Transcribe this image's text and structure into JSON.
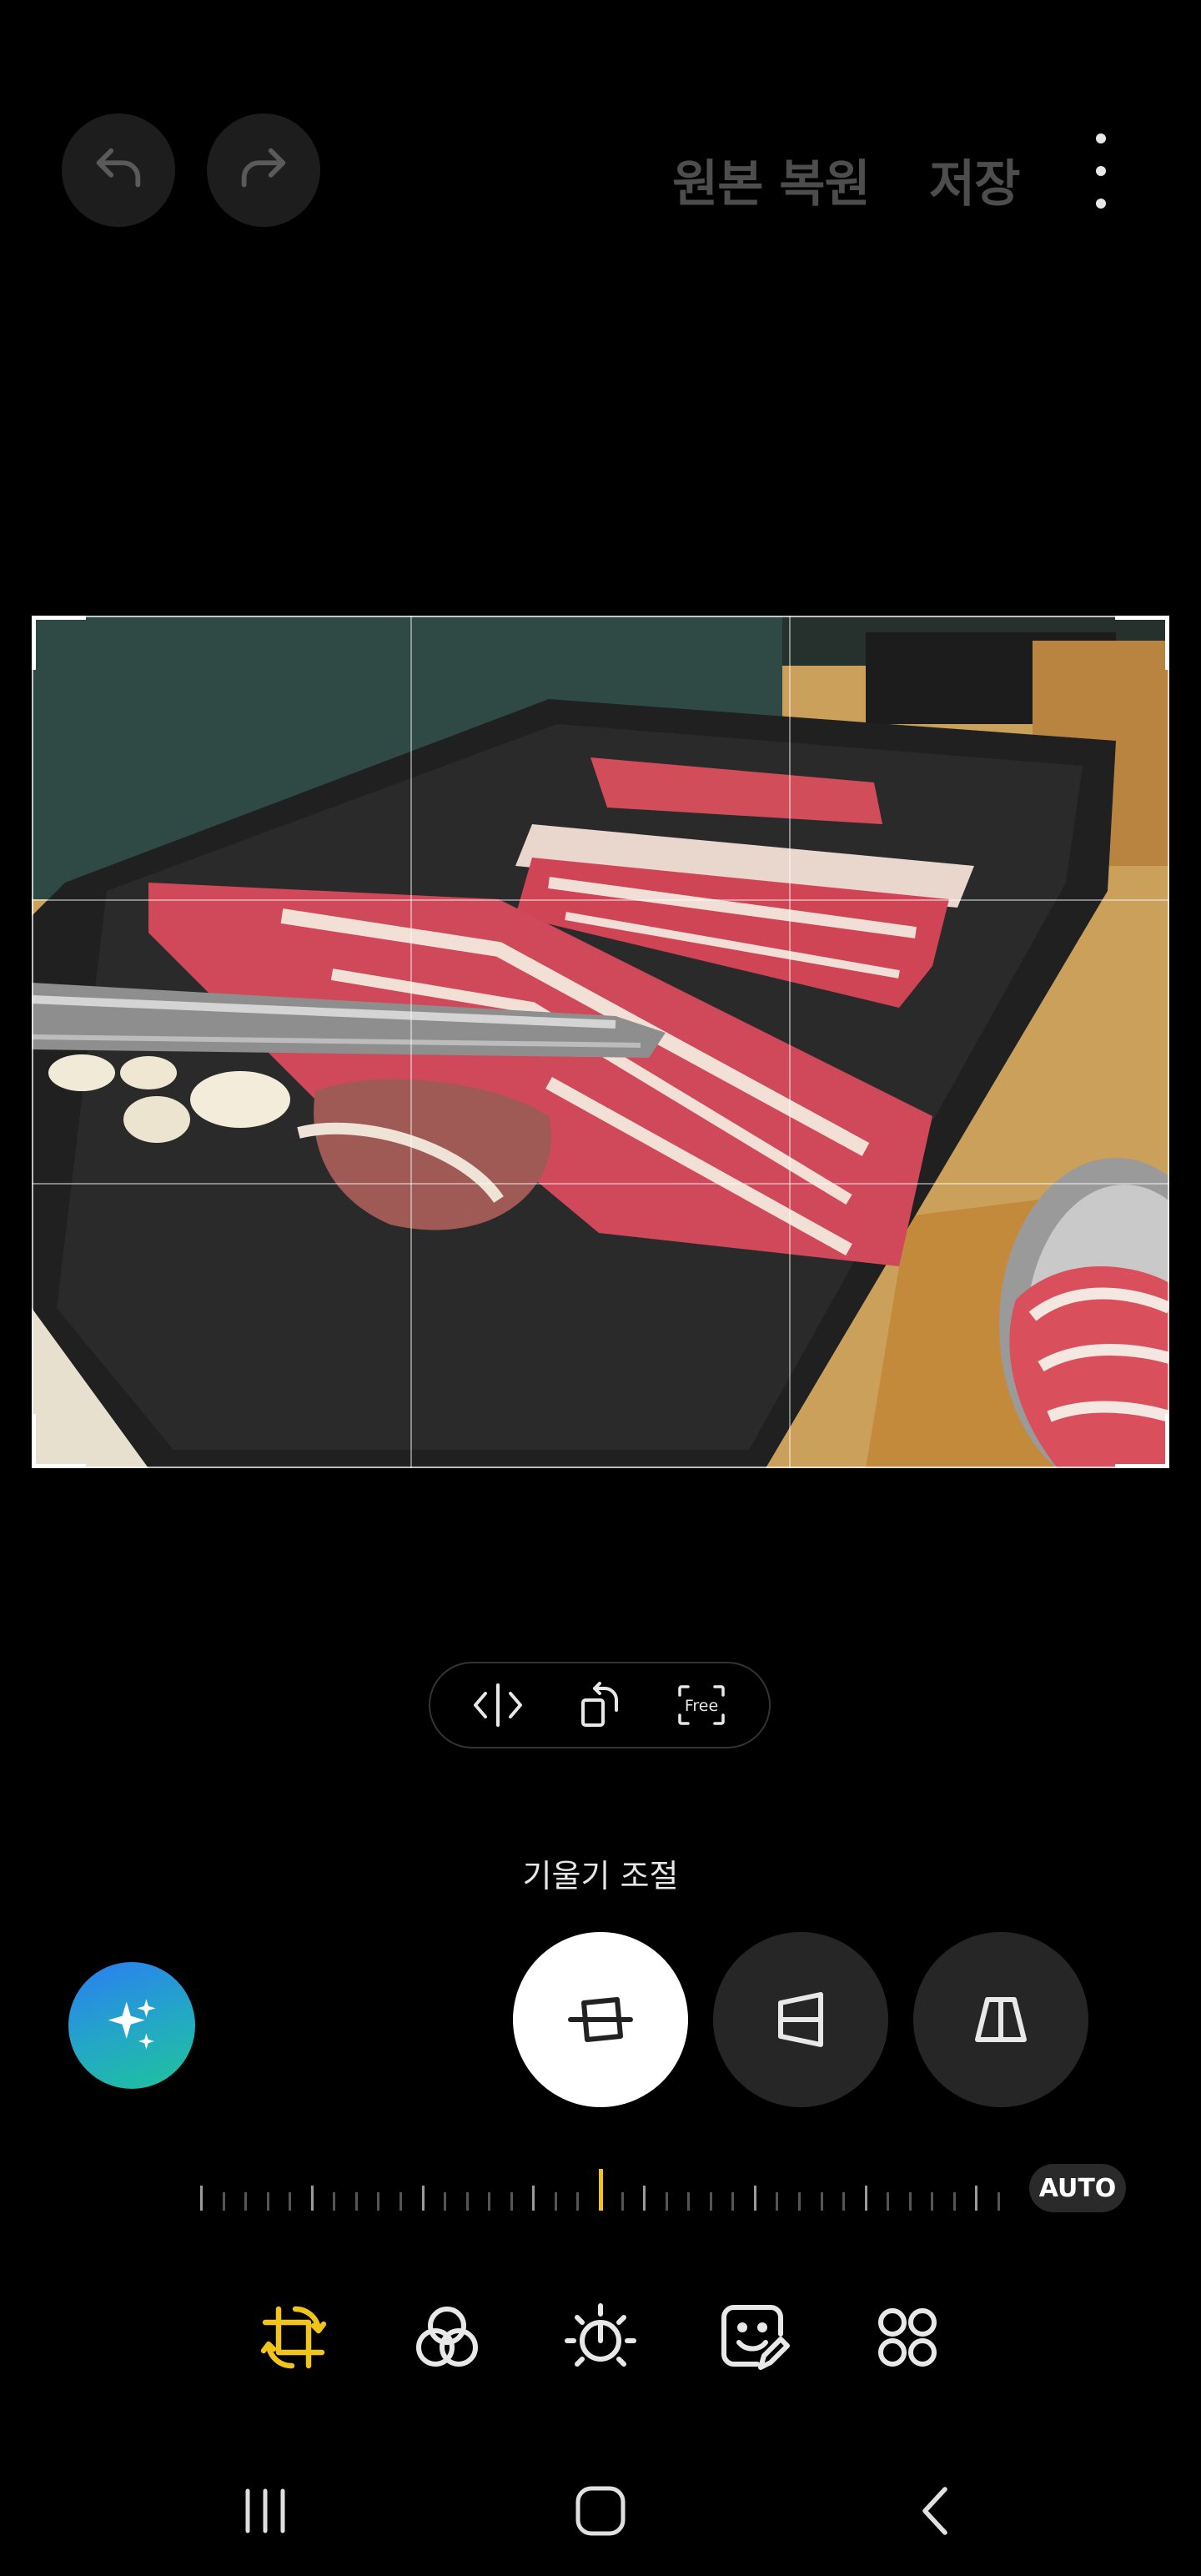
{
  "top_bar": {
    "undo_icon": "undo-arrow-icon",
    "redo_icon": "redo-arrow-icon",
    "revert_label": "원본 복원",
    "save_label": "저장",
    "more_icon": "more-vertical-icon"
  },
  "photo": {
    "subject": "",
    "crop_grid": "3x3"
  },
  "transform_pill": {
    "items": [
      {
        "icon": "flip-horizontal-icon"
      },
      {
        "icon": "rotate-icon"
      },
      {
        "icon": "aspect-ratio-icon",
        "text": "Free"
      }
    ]
  },
  "tilt": {
    "label": "기울기 조절",
    "modes": [
      {
        "icon": "straighten-icon",
        "active": true
      },
      {
        "icon": "vertical-perspective-icon",
        "active": false
      },
      {
        "icon": "horizontal-perspective-icon",
        "active": false
      }
    ],
    "auto_label": "AUTO",
    "value": 0
  },
  "ai_button": {
    "icon": "sparkle-icon"
  },
  "tools": [
    {
      "icon": "crop-rotate-icon",
      "active": true
    },
    {
      "icon": "filters-icon",
      "active": false
    },
    {
      "icon": "brightness-icon",
      "active": false
    },
    {
      "icon": "sticker-edit-icon",
      "active": false
    },
    {
      "icon": "more-tools-icon",
      "active": false
    }
  ],
  "nav": {
    "recents_icon": "recents-icon",
    "home_icon": "home-icon",
    "back_icon": "back-icon"
  },
  "colors": {
    "accent": "#f0c419",
    "background": "#000000",
    "muted_text": "#4d4d4d"
  }
}
